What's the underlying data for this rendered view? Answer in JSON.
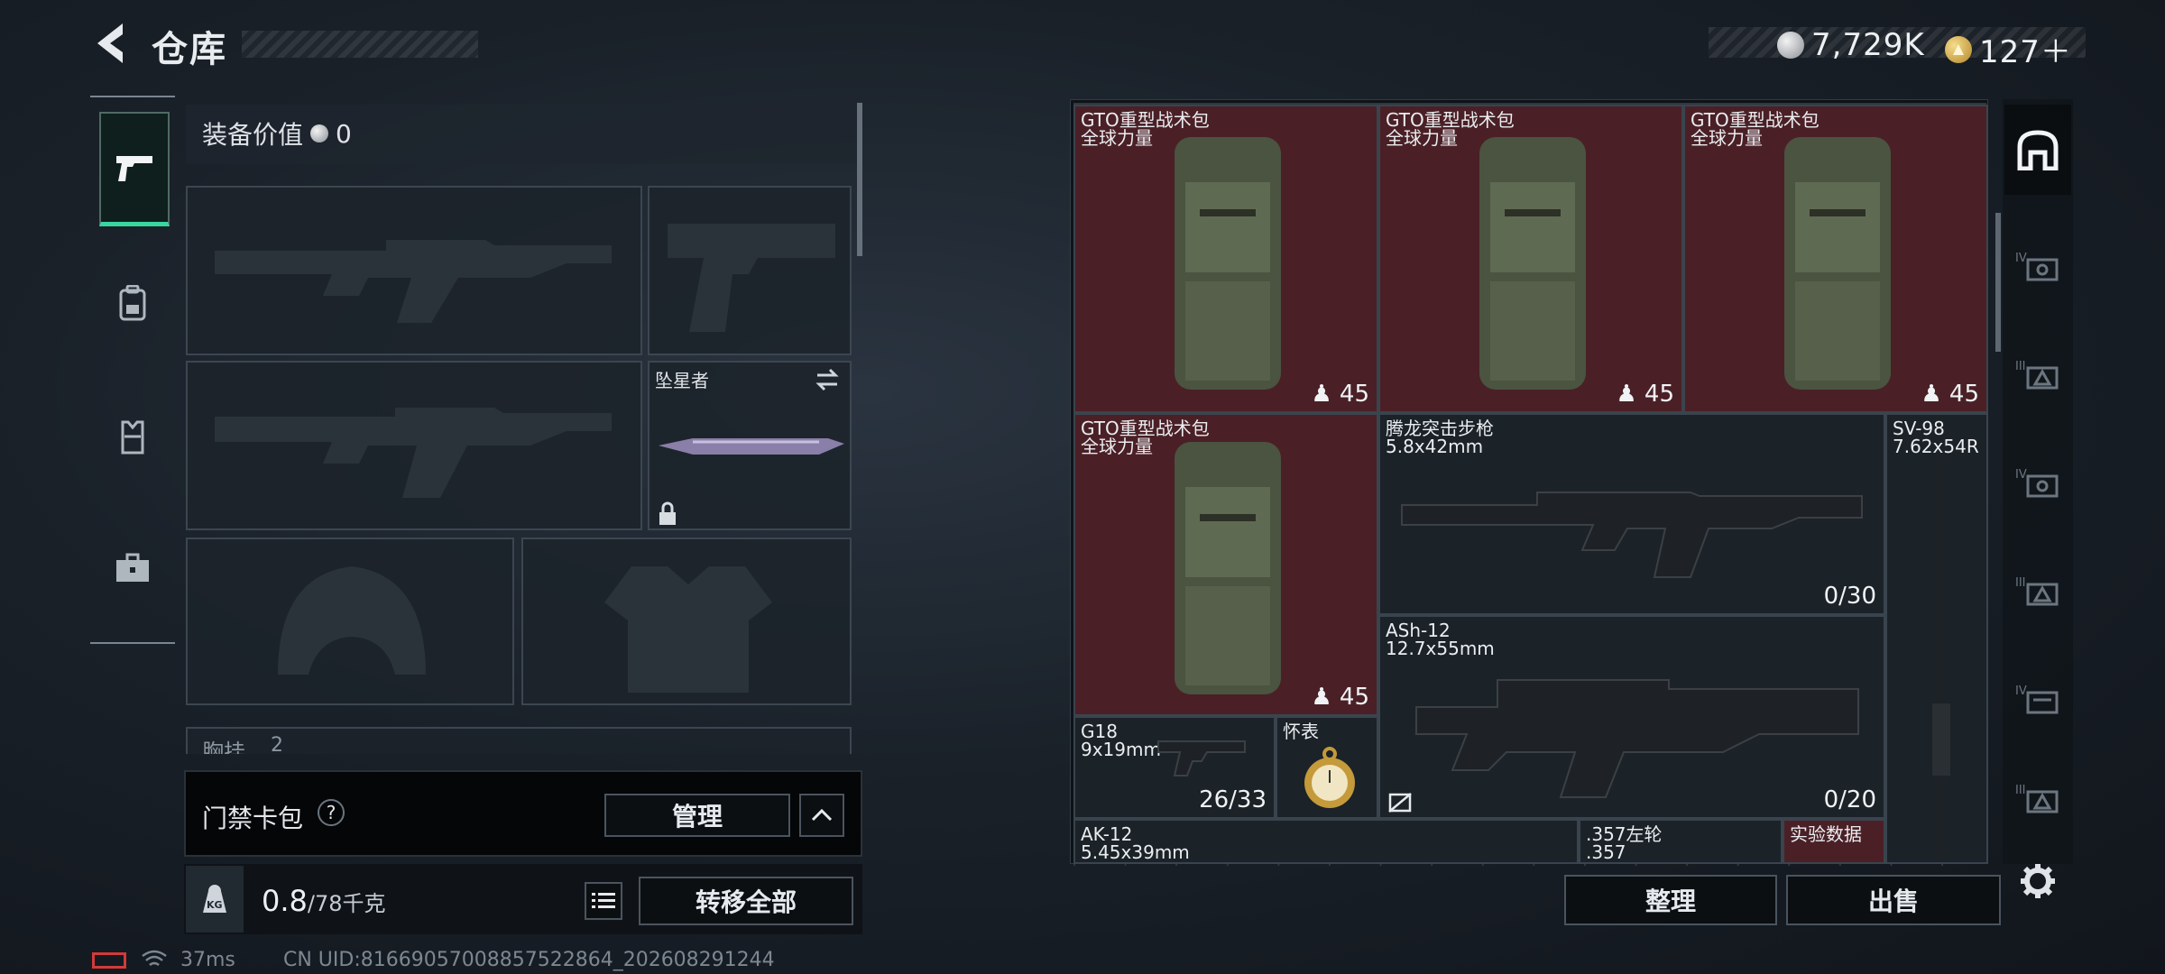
{
  "header": {
    "title": "仓库",
    "currency": {
      "silver": "7,729K",
      "gold": "127＋"
    }
  },
  "left_tabs": [
    "weapon-tab",
    "backpack-tab",
    "vest-tab",
    "medkit-tab"
  ],
  "equipment": {
    "title": "装备价值",
    "value": "0",
    "melee_name": "坠星者",
    "chest_label": "胸挂",
    "chest_count": "2"
  },
  "keycard": {
    "label": "门禁卡包",
    "help": "?",
    "manage_label": "管理"
  },
  "weight": {
    "current": "0.8",
    "max": "/78千克",
    "kg_icon_text": "KG",
    "transfer_all_label": "转移全部"
  },
  "status": {
    "ping": "37ms",
    "uid": "CN UID:8166905700885752​2864_202608291244"
  },
  "storage": {
    "items": [
      {
        "name": "GTO重型战术包",
        "sub": "全球力量",
        "value": "45"
      },
      {
        "name": "GTO重型战术包",
        "sub": "全球力量",
        "value": "45"
      },
      {
        "name": "GTO重型战术包",
        "sub": "全球力量",
        "value": "45"
      },
      {
        "name": "GTO重型战术包",
        "sub": "全球力量",
        "value": "45"
      },
      {
        "name": "腾龙突击步枪",
        "sub": "5.8x42mm",
        "value": "0/30"
      },
      {
        "name": "SV-98",
        "sub": "7.62x54R",
        "value": ""
      },
      {
        "name": "ASh-12",
        "sub": "12.7x55mm",
        "value": "0/20"
      },
      {
        "name": "G18",
        "sub": "9x19mm",
        "value": "26/33"
      },
      {
        "name": "怀表",
        "sub": "",
        "value": ""
      },
      {
        "name": "AK-12",
        "sub": "5.45x39mm",
        "value": ""
      },
      {
        "name": ".357左轮",
        "sub": ".357",
        "value": ""
      },
      {
        "name": "实验数据",
        "sub": "",
        "value": ""
      }
    ],
    "organize_label": "整理",
    "sell_label": "出售"
  },
  "colors": {
    "accent_green": "#39d6a0",
    "item_red_bg": "#4a2026",
    "panel_dark": "#1b2228"
  }
}
